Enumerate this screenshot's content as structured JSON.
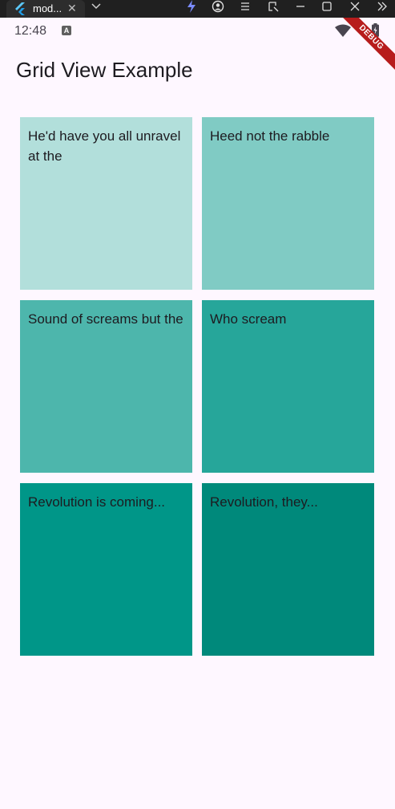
{
  "window": {
    "tab_title": "mod...",
    "tab_close": "✕"
  },
  "status_bar": {
    "time": "12:48",
    "notification_glyph": "A"
  },
  "debug_banner": "DEBUG",
  "app_bar": {
    "title": "Grid View Example"
  },
  "grid": {
    "items": [
      {
        "text": "He'd have you all unravel at the",
        "color": "#b2dfdb"
      },
      {
        "text": "Heed not the rabble",
        "color": "#80cbc4"
      },
      {
        "text": "Sound of screams but the",
        "color": "#4db6ac"
      },
      {
        "text": "Who scream",
        "color": "#26a69a"
      },
      {
        "text": "Revolution is coming...",
        "color": "#009688"
      },
      {
        "text": "Revolution, they...",
        "color": "#00897b"
      }
    ]
  },
  "icons": {
    "tab": "flutter-icon",
    "toolbar": [
      "flash-icon",
      "account-icon",
      "menu-icon",
      "screenshot-icon",
      "minimize-icon",
      "maximize-icon",
      "close-icon",
      "expand-icon"
    ]
  }
}
